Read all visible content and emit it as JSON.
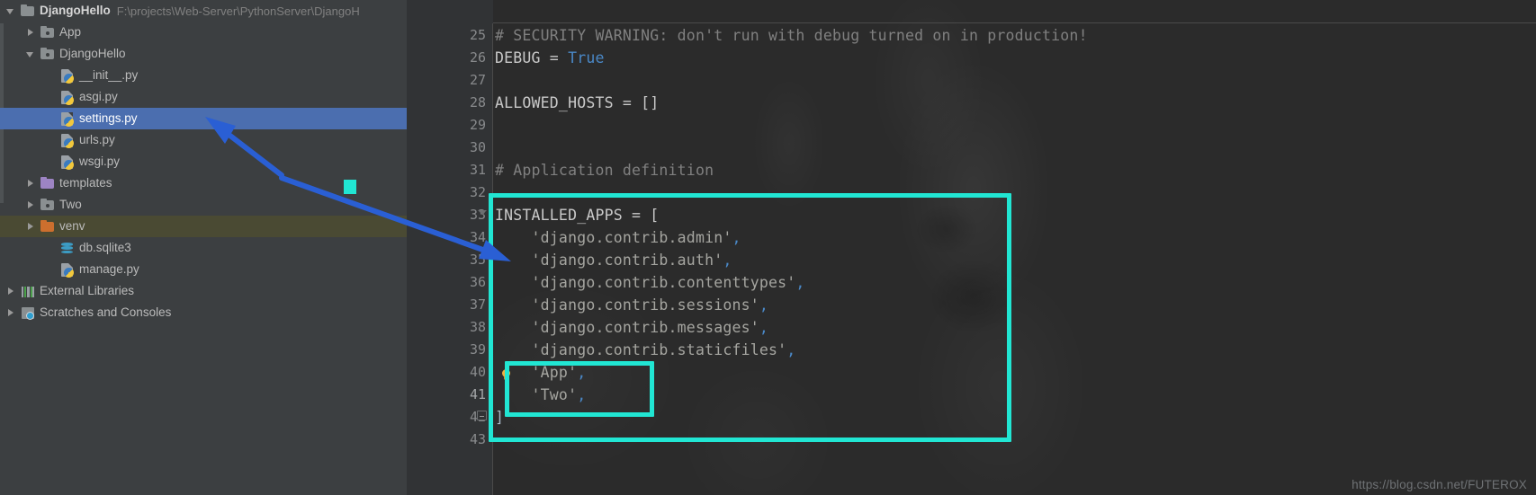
{
  "project": {
    "name": "DjangoHello",
    "path": "F:\\projects\\Web-Server\\PythonServer\\DjangoH"
  },
  "sidebar": {
    "items": [
      {
        "label": "DjangoHello",
        "icon": "folder-gray-icon",
        "toggle": "expanded",
        "indent": 0,
        "state": "root"
      },
      {
        "label": "App",
        "icon": "folder-module-icon",
        "toggle": "collapsed",
        "indent": 1,
        "state": "normal"
      },
      {
        "label": "DjangoHello",
        "icon": "folder-module-icon",
        "toggle": "expanded",
        "indent": 1,
        "state": "normal"
      },
      {
        "label": "__init__.py",
        "icon": "python-file-icon",
        "toggle": "none",
        "indent": 2,
        "state": "normal"
      },
      {
        "label": "asgi.py",
        "icon": "python-file-icon",
        "toggle": "none",
        "indent": 2,
        "state": "normal"
      },
      {
        "label": "settings.py",
        "icon": "python-file-icon",
        "toggle": "none",
        "indent": 2,
        "state": "selected"
      },
      {
        "label": "urls.py",
        "icon": "python-file-icon",
        "toggle": "none",
        "indent": 2,
        "state": "normal"
      },
      {
        "label": "wsgi.py",
        "icon": "python-file-icon",
        "toggle": "none",
        "indent": 2,
        "state": "normal"
      },
      {
        "label": "templates",
        "icon": "folder-purple-icon",
        "toggle": "collapsed",
        "indent": 1,
        "state": "normal"
      },
      {
        "label": "Two",
        "icon": "folder-module-icon",
        "toggle": "collapsed",
        "indent": 1,
        "state": "normal"
      },
      {
        "label": "venv",
        "icon": "folder-orange-icon",
        "toggle": "collapsed",
        "indent": 1,
        "state": "highlight"
      },
      {
        "label": "db.sqlite3",
        "icon": "database-icon",
        "toggle": "none",
        "indent": 2,
        "state": "normal"
      },
      {
        "label": "manage.py",
        "icon": "python-file-icon",
        "toggle": "none",
        "indent": 2,
        "state": "normal"
      },
      {
        "label": "External Libraries",
        "icon": "libraries-icon",
        "toggle": "collapsed",
        "indent": 0,
        "state": "normal"
      },
      {
        "label": "Scratches and Consoles",
        "icon": "scratches-icon",
        "toggle": "collapsed",
        "indent": 0,
        "state": "normal"
      }
    ]
  },
  "editor": {
    "first_line": 25,
    "lines": [
      {
        "n": 25,
        "tokens": [
          {
            "t": "# SECURITY WARNING: don't run with debug turned on in production!",
            "c": "c-comment"
          }
        ]
      },
      {
        "n": 26,
        "tokens": [
          {
            "t": "DEBUG = ",
            "c": "c-ident"
          },
          {
            "t": "True",
            "c": "c-kw"
          }
        ]
      },
      {
        "n": 27,
        "tokens": []
      },
      {
        "n": 28,
        "tokens": [
          {
            "t": "ALLOWED_HOSTS = []",
            "c": "c-ident"
          }
        ]
      },
      {
        "n": 29,
        "tokens": []
      },
      {
        "n": 30,
        "tokens": []
      },
      {
        "n": 31,
        "tokens": [
          {
            "t": "# Application definition",
            "c": "c-comment"
          }
        ]
      },
      {
        "n": 32,
        "tokens": []
      },
      {
        "n": 33,
        "tokens": [
          {
            "t": "INSTALLED_APPS = [",
            "c": "c-ident"
          }
        ]
      },
      {
        "n": 34,
        "tokens": [
          {
            "t": "    'django.contrib.admin'",
            "c": "c-str"
          },
          {
            "t": ",",
            "c": "c-comma"
          }
        ]
      },
      {
        "n": 35,
        "tokens": [
          {
            "t": "    'django.contrib.auth'",
            "c": "c-str"
          },
          {
            "t": ",",
            "c": "c-comma"
          }
        ]
      },
      {
        "n": 36,
        "tokens": [
          {
            "t": "    'django.contrib.contenttypes'",
            "c": "c-str"
          },
          {
            "t": ",",
            "c": "c-comma"
          }
        ]
      },
      {
        "n": 37,
        "tokens": [
          {
            "t": "    'django.contrib.sessions'",
            "c": "c-str"
          },
          {
            "t": ",",
            "c": "c-comma"
          }
        ]
      },
      {
        "n": 38,
        "tokens": [
          {
            "t": "    'django.contrib.messages'",
            "c": "c-str"
          },
          {
            "t": ",",
            "c": "c-comma"
          }
        ]
      },
      {
        "n": 39,
        "tokens": [
          {
            "t": "    'django.contrib.staticfiles'",
            "c": "c-str"
          },
          {
            "t": ",",
            "c": "c-comma"
          }
        ]
      },
      {
        "n": 40,
        "tokens": [
          {
            "t": "    'App'",
            "c": "c-str"
          },
          {
            "t": ",",
            "c": "c-comma"
          }
        ]
      },
      {
        "n": 41,
        "tokens": [
          {
            "t": "    'Two'",
            "c": "c-str"
          },
          {
            "t": ",",
            "c": "c-comma"
          }
        ]
      },
      {
        "n": 42,
        "tokens": [
          {
            "t": "]",
            "c": "c-punc"
          }
        ]
      },
      {
        "n": 43,
        "tokens": []
      }
    ]
  },
  "annotations": {
    "accent_color": "#21e6d3",
    "arrow_color": "#2a5fd4",
    "outer_box_label": "installed-apps-block",
    "inner_box_label": "custom-apps-block"
  },
  "watermark": {
    "text": "https://blog.csdn.net/FUTEROX"
  },
  "colors": {
    "sidebar_bg": "#3c3f41",
    "editor_bg": "#2b2b2b",
    "gutter_bg": "#313335",
    "selection_blue": "#4b6eaf",
    "highlight_olive": "#4a4a33"
  }
}
